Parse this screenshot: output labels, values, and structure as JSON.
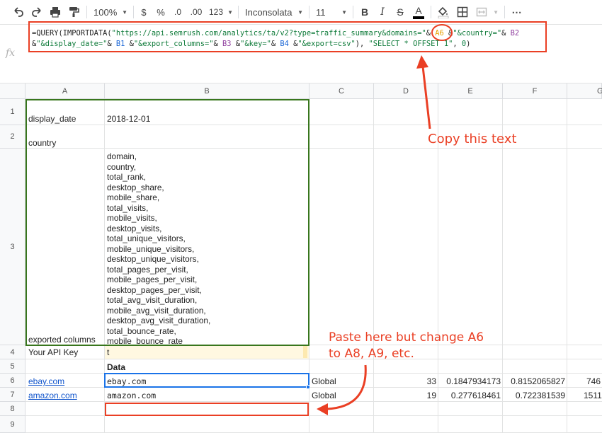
{
  "toolbar": {
    "zoom": "100%",
    "currency": "$",
    "percent": "%",
    "decrease_decimals": ".0",
    "increase_decimals": ".00",
    "more_formats": "123",
    "font": "Inconsolata",
    "font_size": "11",
    "bold": "B",
    "italic": "I",
    "strikethrough": "S",
    "text_color_glyph": "A"
  },
  "formula_bar": {
    "fx": "fx",
    "p1": "=QUERY(IMPORTDATA(",
    "p2": "\"https://api.semrush.com/analytics/ta/v2?type=traffic_summary&domains=\"",
    "p3": "& ",
    "p4": "A6",
    "p5": " &",
    "p6": "\"&country=\"",
    "p7": "& ",
    "p8": "B2",
    "p9": "&",
    "p10": "\"&display_date=\"",
    "p11": "& ",
    "p12": "B1",
    "p13": " &",
    "p14": "\"&export_columns=\"",
    "p15": "& ",
    "p16": "B3",
    "p17": " &",
    "p18": "\"&key=\"",
    "p19": "& ",
    "p20": "B4",
    "p21": " &",
    "p22": "\"&export=csv\"",
    "p23": "), ",
    "p24": "\"SELECT * OFFSET 1\"",
    "p25": ", ",
    "p26": "0",
    "p27": ")"
  },
  "columns": [
    "A",
    "B",
    "C",
    "D",
    "E",
    "F",
    "G"
  ],
  "rows": [
    "1",
    "2",
    "3",
    "4",
    "5",
    "6",
    "7",
    "8",
    "9"
  ],
  "cells": {
    "a1": "display_date",
    "b1": "2018-12-01",
    "a2": "country",
    "a3": "exported columns",
    "b3_list": "domain,\ncountry,\ntotal_rank,\ndesktop_share,\nmobile_share,\ntotal_visits,\nmobile_visits,\ndesktop_visits,\ntotal_unique_visitors,\nmobile_unique_visitors,\ndesktop_unique_visitors,\ntotal_pages_per_visit,\nmobile_pages_per_visit,\ndesktop_pages_per_visit,\ntotal_avg_visit_duration,\nmobile_avg_visit_duration,\ndesktop_avg_visit_duration,\ntotal_bounce_rate,\nmobile_bounce_rate",
    "a4": "Your API Key",
    "b4": "t",
    "b5": "Data",
    "a6": "ebay.com",
    "b6": "ebay.com",
    "c6": "Global",
    "d6": "33",
    "e6": "0.1847934173",
    "f6": "0.8152065827",
    "g6": "746",
    "a7": "amazon.com",
    "b7": "amazon.com",
    "c7": "Global",
    "d7": "19",
    "e7": "0.277618461",
    "f7": "0.722381539",
    "g7": "1511"
  },
  "annotations": {
    "copy": "Copy this text",
    "paste_line1": "Paste here but change A6",
    "paste_line2": "to A8, A9, etc."
  },
  "colors": {
    "annotation_red": "#ea3f24",
    "link_blue": "#1155cc",
    "range_green": "#38761d"
  }
}
